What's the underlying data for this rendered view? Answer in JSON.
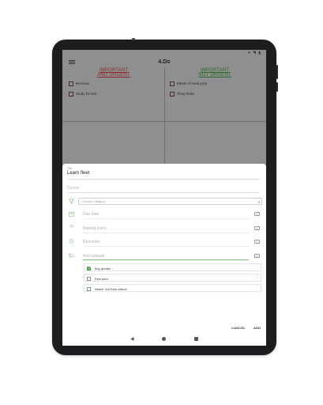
{
  "app": {
    "title": "4.Do"
  },
  "status_bar": {
    "icons": "▾ ◥ ▮"
  },
  "quadrants": {
    "q1": {
      "line1": "IMPORTANT",
      "line2": "AND URGENT",
      "color": "#8b2a2a",
      "tasks": [
        "Exercise",
        "Study for test"
      ]
    },
    "q2": {
      "line1": "IMPORTANT",
      "line2": "NOT URGENT",
      "color": "#2b6a2b",
      "tasks": [
        "Meals of meal prep",
        "Shop Rollo"
      ]
    }
  },
  "sheet": {
    "title_label": "Title",
    "title_value": "Learn fleet",
    "details_placeholder": "Details",
    "category": {
      "selected": "Choose Category"
    },
    "due_date_label": "Due date",
    "repeat_label": "Repeat every",
    "reminder_label": "Reminder",
    "add_subtask_label": "Add subtask",
    "subtasks": [
      {
        "text": "Buy quotes",
        "checked": true
      },
      {
        "text": "Find tutor",
        "checked": false
      },
      {
        "text": "Watch YouTube videos",
        "checked": false
      }
    ],
    "cancel_label": "CANCEL",
    "add_label": "ADD"
  },
  "icons": {
    "menu": "menu-icon",
    "category": "filter-icon",
    "due_date": "calendar-icon",
    "repeat": "repeat-icon",
    "reminder": "alarm-icon",
    "subtask": "subtask-icon",
    "clear": "clear-icon",
    "more": "more-vertical-icon",
    "nav_back": "back-triangle-icon",
    "nav_home": "home-circle-icon",
    "nav_recent": "recents-square-icon"
  },
  "colors": {
    "accent_green": "#5aa55a",
    "urgent_red": "#8b2a2a",
    "not_urgent_green": "#2b6a2b"
  }
}
